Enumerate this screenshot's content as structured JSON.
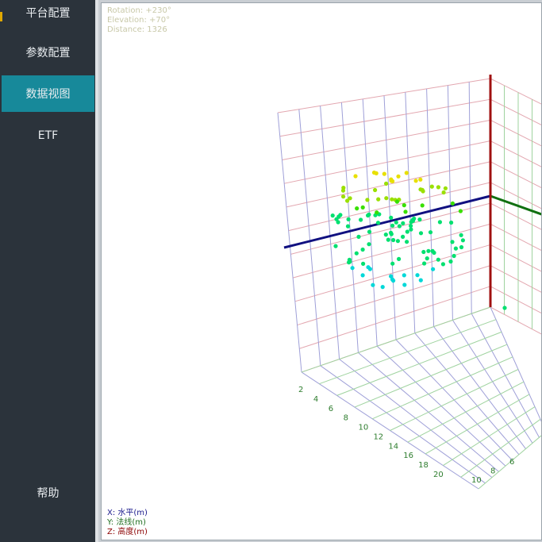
{
  "sidebar": {
    "items": [
      {
        "label": "平台配置",
        "active": false
      },
      {
        "label": "参数配置",
        "active": false
      },
      {
        "label": "数据视图",
        "active": true
      },
      {
        "label": "ETF",
        "active": false
      }
    ],
    "help_label": "帮助",
    "accent_color": "#17899a"
  },
  "view": {
    "rotation": "Rotation:  +230°",
    "elevation": "Elevation: +70°",
    "distance": "Distance:  1326"
  },
  "legend": {
    "x": {
      "label": "X: 水平(m)",
      "color": "#1a1a8c"
    },
    "y": {
      "label": "Y: 法线(m)",
      "color": "#1e6e1e"
    },
    "z": {
      "label": "Z: 高度(m)",
      "color": "#8b0000"
    }
  },
  "axis_ticks": {
    "y_ticks": [
      "2",
      "4",
      "6",
      "8",
      "10",
      "12",
      "14",
      "16",
      "18",
      "20"
    ],
    "x_ticks": [
      "10",
      "8",
      "6"
    ]
  },
  "colors": {
    "point_colormap": [
      "#00d8d8",
      "#00e070",
      "#38e000",
      "#9ae000",
      "#e8e000"
    ],
    "axis_x": "#101080",
    "axis_y": "#107010",
    "axis_z": "#a01010"
  }
}
